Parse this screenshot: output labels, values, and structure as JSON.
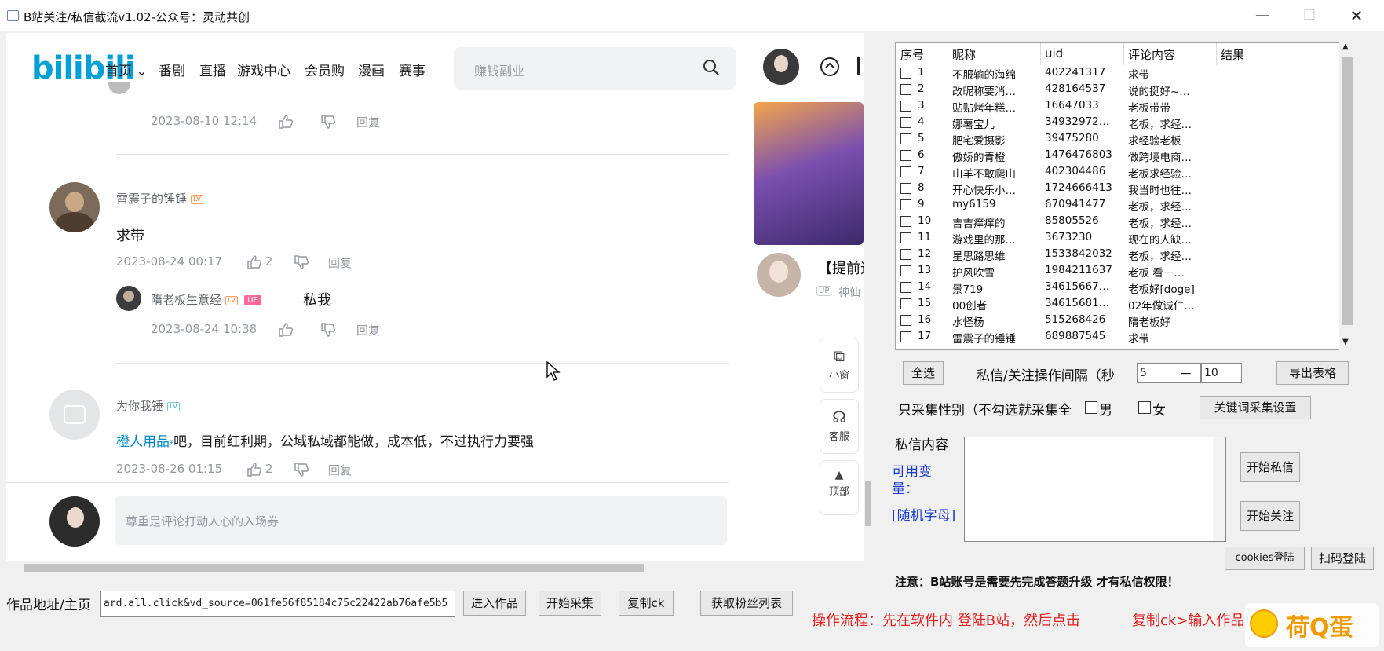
{
  "window": {
    "title": "B站关注/私信截流v1.02-公众号：灵动共创",
    "min": "—",
    "max": "☐",
    "close": "✕"
  },
  "bili": {
    "logo": "bilibili",
    "nav": [
      "首页",
      "番剧",
      "直播",
      "游戏中心",
      "会员购",
      "漫画",
      "赛事"
    ],
    "nav_caret": "⌄",
    "search_placeholder": "赚钱副业",
    "side_title": "【提前追",
    "side_sub": "神仙",
    "side_up": "UP"
  },
  "comments": {
    "c0_meta": "2023-08-10 12:14",
    "c0_reply": "回复",
    "c1_name": "雷震子的锤锤",
    "c1_text": "求带",
    "c1_date": "2023-08-24 00:17",
    "c1_likes": "2",
    "c1_reply": "回复",
    "c2_name": "隋老板生意经",
    "c2_up": "UP",
    "c2_text": "私我",
    "c2_date": "2023-08-24 10:38",
    "c2_reply": "回复",
    "c3_name": "为你我锤",
    "c3_link": "橙人用品",
    "c3_text": "吧，目前红利期，公域私域都能做，成本低，不过执行力要强",
    "c3_date": "2023-08-26 01:15",
    "c3_likes": "2",
    "c3_reply": "回复",
    "reply_placeholder": "尊重是评论打动人心的入场券"
  },
  "sidebar": {
    "mini": "小窗",
    "service": "客服",
    "top": "顶部"
  },
  "table": {
    "headers": [
      "序号",
      "昵称",
      "uid",
      "评论内容",
      "结果"
    ],
    "rows": [
      [
        "1",
        "不服输的海绵",
        "402241317",
        "求带"
      ],
      [
        "2",
        "改昵称要消…",
        "428164537",
        "说的挺好~…"
      ],
      [
        "3",
        "贴贴烤年糕…",
        "16647033",
        "老板带带"
      ],
      [
        "4",
        "娜薯宝儿",
        "34932972…",
        "老板，求经…"
      ],
      [
        "5",
        "肥宅爱摄影",
        "39475280",
        "求经验老板"
      ],
      [
        "6",
        "傲娇的青橙",
        "1476476803",
        "做跨境电商…"
      ],
      [
        "7",
        "山羊不敢爬山",
        "402304486",
        "老板求经验…"
      ],
      [
        "8",
        "开心快乐小…",
        "1724666413",
        "我当时也往…"
      ],
      [
        "9",
        "my6159",
        "670941477",
        "老板，求经…"
      ],
      [
        "10",
        "吉吉痒痒的",
        "85805526",
        "老板，求经…"
      ],
      [
        "11",
        "游戏里的那…",
        "3673230",
        "现在的人缺…"
      ],
      [
        "12",
        "星思路思维",
        "1533842032",
        "老板，求经…"
      ],
      [
        "13",
        "护风吹雪",
        "1984211637",
        "老板 看一…"
      ],
      [
        "14",
        "景719",
        "34615667…",
        "老板好[doge]"
      ],
      [
        "15",
        "00创者",
        "34615681…",
        "02年做诚仁…"
      ],
      [
        "16",
        "水怪杨",
        "515268426",
        "隋老板好"
      ],
      [
        "17",
        "雷震子的锤锤",
        "689887545",
        "求带"
      ]
    ]
  },
  "controls": {
    "select_all": "全选",
    "interval_label": "私信/关注操作间隔（秒",
    "interval_min": "5",
    "interval_dash": "－",
    "interval_max": "10",
    "export": "导出表格",
    "gender_label": "只采集性别（不勾选就采集全",
    "male": "男",
    "female": "女",
    "keyword_settings": "关键词采集设置",
    "dm_label": "私信内容",
    "var_label": "可用变量：",
    "random_label": "[随机字母]",
    "start_dm": "开始私信",
    "start_follow": "开始关注",
    "cookies_login": "cookies登陆",
    "qr_login": "扫码登陆",
    "notice": "注意：B站账号是需要先完成答题升级 才有私信权限！",
    "flow": "操作流程：先在软件内 登陆B站，然后点击",
    "flow2": "复制ck>输入作品…",
    "work_label": "作品地址/主页",
    "work_url": "ard.all.click&vd_source=061fe56f85184c75c22422ab76afe5b5",
    "enter_work": "进入作品",
    "start_collect": "开始采集",
    "copy_ck": "复制ck",
    "get_fans": "获取粉丝列表"
  },
  "watermark": "荷Q蛋"
}
